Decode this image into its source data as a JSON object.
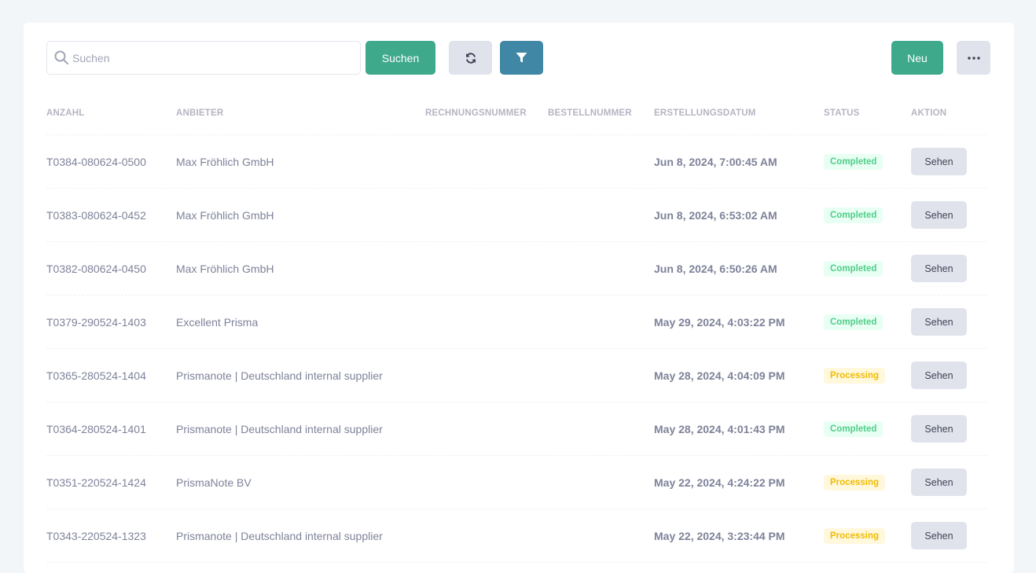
{
  "colors": {
    "accent_green": "#3ea98b",
    "accent_blue": "#3f87a4",
    "completed_text": "#50cd89",
    "completed_bg": "#e8fff3",
    "processing_text": "#f1bc00",
    "processing_bg": "#fff8dd"
  },
  "toolbar": {
    "search_placeholder": "Suchen",
    "search_value": "",
    "search_button": "Suchen",
    "refresh_icon": "refresh-icon",
    "filter_icon": "filter-icon",
    "new_button": "Neu",
    "more_icon": "more-dots-icon"
  },
  "table": {
    "columns": [
      "ANZAHL",
      "ANBIETER",
      "RECHNUNGSNUMMER",
      "BESTELLNUMMER",
      "ERSTELLUNGSDATUM",
      "STATUS",
      "AKTION"
    ],
    "rows": [
      {
        "anzahl": "T0384-080624-0500",
        "anbieter": "Max Fröhlich GmbH",
        "rechnung": "",
        "bestell": "",
        "datum": "Jun 8, 2024, 7:00:45 AM",
        "status": "Completed",
        "aktion": "Sehen"
      },
      {
        "anzahl": "T0383-080624-0452",
        "anbieter": "Max Fröhlich GmbH",
        "rechnung": "",
        "bestell": "",
        "datum": "Jun 8, 2024, 6:53:02 AM",
        "status": "Completed",
        "aktion": "Sehen"
      },
      {
        "anzahl": "T0382-080624-0450",
        "anbieter": "Max Fröhlich GmbH",
        "rechnung": "",
        "bestell": "",
        "datum": "Jun 8, 2024, 6:50:26 AM",
        "status": "Completed",
        "aktion": "Sehen"
      },
      {
        "anzahl": "T0379-290524-1403",
        "anbieter": "Excellent Prisma",
        "rechnung": "",
        "bestell": "",
        "datum": "May 29, 2024, 4:03:22 PM",
        "status": "Completed",
        "aktion": "Sehen"
      },
      {
        "anzahl": "T0365-280524-1404",
        "anbieter": "Prismanote | Deutschland internal supplier",
        "rechnung": "",
        "bestell": "",
        "datum": "May 28, 2024, 4:04:09 PM",
        "status": "Processing",
        "aktion": "Sehen"
      },
      {
        "anzahl": "T0364-280524-1401",
        "anbieter": "Prismanote | Deutschland internal supplier",
        "rechnung": "",
        "bestell": "",
        "datum": "May 28, 2024, 4:01:43 PM",
        "status": "Completed",
        "aktion": "Sehen"
      },
      {
        "anzahl": "T0351-220524-1424",
        "anbieter": "PrismaNote BV",
        "rechnung": "",
        "bestell": "",
        "datum": "May 22, 2024, 4:24:22 PM",
        "status": "Processing",
        "aktion": "Sehen"
      },
      {
        "anzahl": "T0343-220524-1323",
        "anbieter": "Prismanote | Deutschland internal supplier",
        "rechnung": "",
        "bestell": "",
        "datum": "May 22, 2024, 3:23:44 PM",
        "status": "Processing",
        "aktion": "Sehen"
      }
    ]
  }
}
